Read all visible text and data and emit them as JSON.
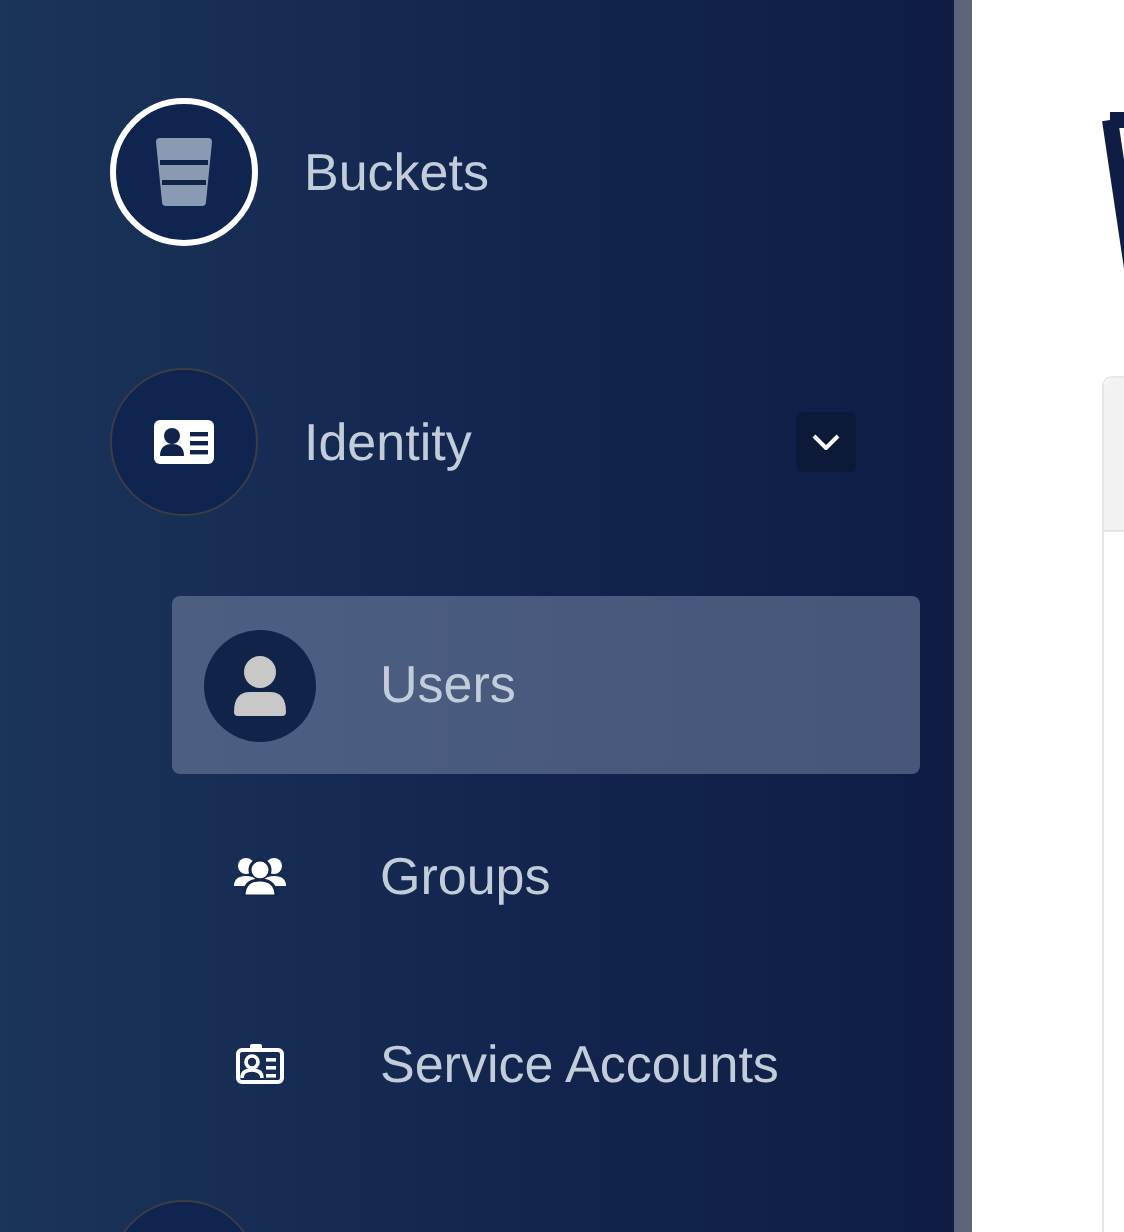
{
  "nav": [
    {
      "kind": "item",
      "label": "Buckets",
      "active": true
    },
    {
      "kind": "group",
      "label": "Identity",
      "active": false,
      "expanded": true,
      "children": [
        {
          "label": "Users",
          "selected": true
        },
        {
          "label": "Groups",
          "selected": false
        },
        {
          "label": "Service Accounts",
          "selected": false
        }
      ]
    },
    {
      "kind": "item",
      "active": false
    }
  ]
}
